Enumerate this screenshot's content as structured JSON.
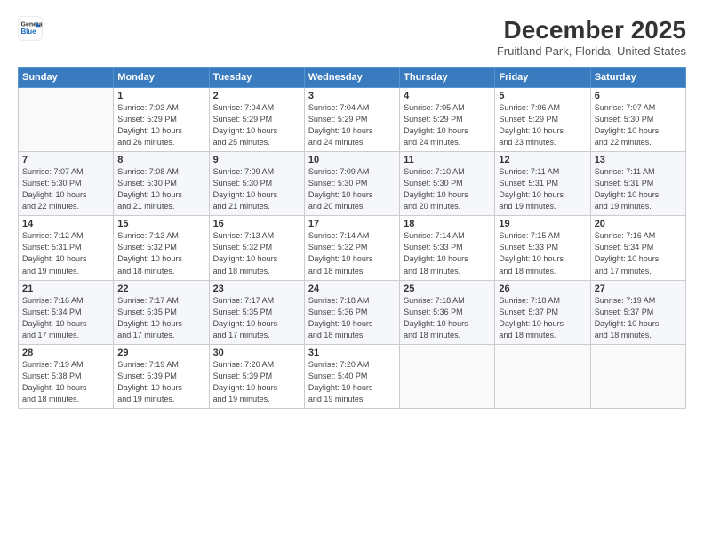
{
  "logo": {
    "line1": "General",
    "line2": "Blue"
  },
  "title": "December 2025",
  "subtitle": "Fruitland Park, Florida, United States",
  "headers": [
    "Sunday",
    "Monday",
    "Tuesday",
    "Wednesday",
    "Thursday",
    "Friday",
    "Saturday"
  ],
  "weeks": [
    [
      {
        "num": "",
        "info": ""
      },
      {
        "num": "1",
        "info": "Sunrise: 7:03 AM\nSunset: 5:29 PM\nDaylight: 10 hours\nand 26 minutes."
      },
      {
        "num": "2",
        "info": "Sunrise: 7:04 AM\nSunset: 5:29 PM\nDaylight: 10 hours\nand 25 minutes."
      },
      {
        "num": "3",
        "info": "Sunrise: 7:04 AM\nSunset: 5:29 PM\nDaylight: 10 hours\nand 24 minutes."
      },
      {
        "num": "4",
        "info": "Sunrise: 7:05 AM\nSunset: 5:29 PM\nDaylight: 10 hours\nand 24 minutes."
      },
      {
        "num": "5",
        "info": "Sunrise: 7:06 AM\nSunset: 5:29 PM\nDaylight: 10 hours\nand 23 minutes."
      },
      {
        "num": "6",
        "info": "Sunrise: 7:07 AM\nSunset: 5:30 PM\nDaylight: 10 hours\nand 22 minutes."
      }
    ],
    [
      {
        "num": "7",
        "info": "Sunrise: 7:07 AM\nSunset: 5:30 PM\nDaylight: 10 hours\nand 22 minutes."
      },
      {
        "num": "8",
        "info": "Sunrise: 7:08 AM\nSunset: 5:30 PM\nDaylight: 10 hours\nand 21 minutes."
      },
      {
        "num": "9",
        "info": "Sunrise: 7:09 AM\nSunset: 5:30 PM\nDaylight: 10 hours\nand 21 minutes."
      },
      {
        "num": "10",
        "info": "Sunrise: 7:09 AM\nSunset: 5:30 PM\nDaylight: 10 hours\nand 20 minutes."
      },
      {
        "num": "11",
        "info": "Sunrise: 7:10 AM\nSunset: 5:30 PM\nDaylight: 10 hours\nand 20 minutes."
      },
      {
        "num": "12",
        "info": "Sunrise: 7:11 AM\nSunset: 5:31 PM\nDaylight: 10 hours\nand 19 minutes."
      },
      {
        "num": "13",
        "info": "Sunrise: 7:11 AM\nSunset: 5:31 PM\nDaylight: 10 hours\nand 19 minutes."
      }
    ],
    [
      {
        "num": "14",
        "info": "Sunrise: 7:12 AM\nSunset: 5:31 PM\nDaylight: 10 hours\nand 19 minutes."
      },
      {
        "num": "15",
        "info": "Sunrise: 7:13 AM\nSunset: 5:32 PM\nDaylight: 10 hours\nand 18 minutes."
      },
      {
        "num": "16",
        "info": "Sunrise: 7:13 AM\nSunset: 5:32 PM\nDaylight: 10 hours\nand 18 minutes."
      },
      {
        "num": "17",
        "info": "Sunrise: 7:14 AM\nSunset: 5:32 PM\nDaylight: 10 hours\nand 18 minutes."
      },
      {
        "num": "18",
        "info": "Sunrise: 7:14 AM\nSunset: 5:33 PM\nDaylight: 10 hours\nand 18 minutes."
      },
      {
        "num": "19",
        "info": "Sunrise: 7:15 AM\nSunset: 5:33 PM\nDaylight: 10 hours\nand 18 minutes."
      },
      {
        "num": "20",
        "info": "Sunrise: 7:16 AM\nSunset: 5:34 PM\nDaylight: 10 hours\nand 17 minutes."
      }
    ],
    [
      {
        "num": "21",
        "info": "Sunrise: 7:16 AM\nSunset: 5:34 PM\nDaylight: 10 hours\nand 17 minutes."
      },
      {
        "num": "22",
        "info": "Sunrise: 7:17 AM\nSunset: 5:35 PM\nDaylight: 10 hours\nand 17 minutes."
      },
      {
        "num": "23",
        "info": "Sunrise: 7:17 AM\nSunset: 5:35 PM\nDaylight: 10 hours\nand 17 minutes."
      },
      {
        "num": "24",
        "info": "Sunrise: 7:18 AM\nSunset: 5:36 PM\nDaylight: 10 hours\nand 18 minutes."
      },
      {
        "num": "25",
        "info": "Sunrise: 7:18 AM\nSunset: 5:36 PM\nDaylight: 10 hours\nand 18 minutes."
      },
      {
        "num": "26",
        "info": "Sunrise: 7:18 AM\nSunset: 5:37 PM\nDaylight: 10 hours\nand 18 minutes."
      },
      {
        "num": "27",
        "info": "Sunrise: 7:19 AM\nSunset: 5:37 PM\nDaylight: 10 hours\nand 18 minutes."
      }
    ],
    [
      {
        "num": "28",
        "info": "Sunrise: 7:19 AM\nSunset: 5:38 PM\nDaylight: 10 hours\nand 18 minutes."
      },
      {
        "num": "29",
        "info": "Sunrise: 7:19 AM\nSunset: 5:39 PM\nDaylight: 10 hours\nand 19 minutes."
      },
      {
        "num": "30",
        "info": "Sunrise: 7:20 AM\nSunset: 5:39 PM\nDaylight: 10 hours\nand 19 minutes."
      },
      {
        "num": "31",
        "info": "Sunrise: 7:20 AM\nSunset: 5:40 PM\nDaylight: 10 hours\nand 19 minutes."
      },
      {
        "num": "",
        "info": ""
      },
      {
        "num": "",
        "info": ""
      },
      {
        "num": "",
        "info": ""
      }
    ]
  ]
}
